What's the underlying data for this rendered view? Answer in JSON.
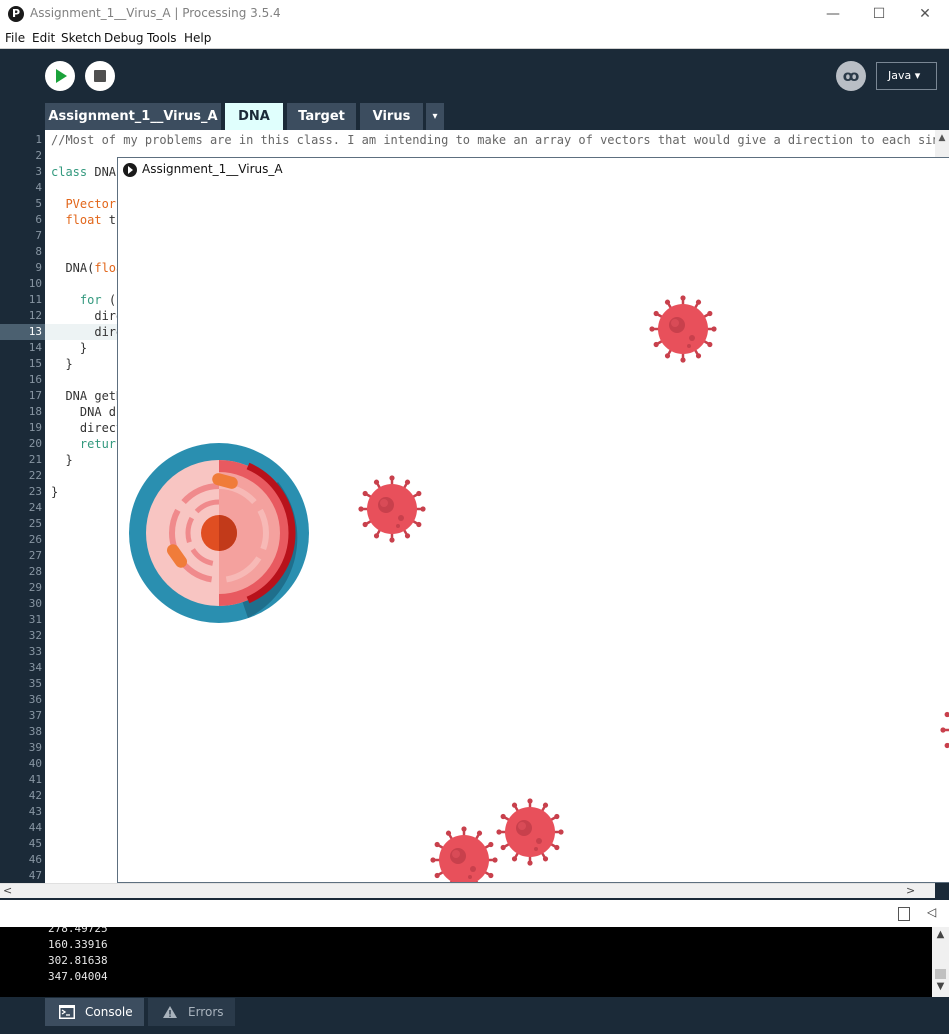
{
  "window": {
    "title": "Assignment_1__Virus_A | Processing 3.5.4",
    "logo_letter": "P",
    "minimize": "—",
    "maximize": "☐",
    "close": "✕"
  },
  "menu": [
    "File",
    "Edit",
    "Sketch",
    "Debug",
    "Tools",
    "Help"
  ],
  "toolbar": {
    "mode": "Java ▾",
    "debug_glyph": "ꝏ"
  },
  "tabs": [
    {
      "label": "Assignment_1__Virus_A",
      "active": false
    },
    {
      "label": "DNA",
      "active": true
    },
    {
      "label": "Target",
      "active": false
    },
    {
      "label": "Virus",
      "active": false
    }
  ],
  "tab_menu": "▾",
  "line_numbers": [
    "1",
    "2",
    "3",
    "4",
    "5",
    "6",
    "7",
    "8",
    "9",
    "10",
    "11",
    "12",
    "13",
    "14",
    "15",
    "16",
    "17",
    "18",
    "19",
    "20",
    "21",
    "22",
    "23",
    "24",
    "25",
    "26",
    "27",
    "28",
    "29",
    "30",
    "31",
    "32",
    "33",
    "34",
    "35",
    "36",
    "37",
    "38",
    "39",
    "40",
    "41",
    "42",
    "43",
    "44",
    "45",
    "46",
    "47"
  ],
  "current_line": 13,
  "code": [
    "//Most of my problems are in this class. I am intending to make an array of vectors that would give a direction to each sing",
    "",
    "class DNA",
    "",
    "  PVector[",
    "  float th",
    "",
    "",
    "  DNA(floa",
    "",
    "    for (",
    "      dire",
    "      dire",
    "    }",
    "  }",
    "",
    "  DNA getD",
    "    DNA dn",
    "    direct",
    "    return",
    "  }",
    "",
    "}"
  ],
  "console": {
    "lines": [
      "278.49725",
      "160.33916",
      "302.81638",
      "347.04004"
    ]
  },
  "bottom_tabs": {
    "console": "Console",
    "errors": "Errors"
  },
  "sketch": {
    "title": "Assignment_1__Virus_A"
  },
  "colors": {
    "editor_bg": "#1b2a38",
    "active_tab": "#e0fffd",
    "virus": "#e8505b",
    "cell_ring": "#2a8fb0",
    "cell_inner": "#e85a60"
  }
}
